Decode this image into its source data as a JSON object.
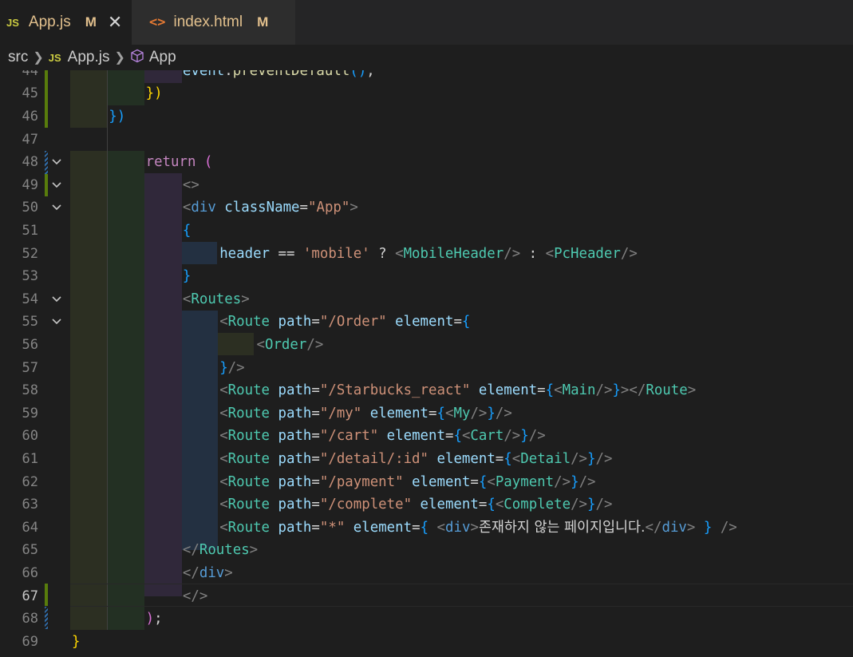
{
  "tabs": [
    {
      "icon": "JS",
      "name": "App.js",
      "status": "M",
      "close": "✕"
    },
    {
      "icon": "<>",
      "name": "index.html",
      "status": "M"
    }
  ],
  "breadcrumb": {
    "folder": "src",
    "file_icon": "JS",
    "file": "App.js",
    "symbol": "App"
  },
  "code": {
    "lines": {
      "44": [
        "event",
        ".",
        "preventDefault",
        "(",
        ")",
        ";"
      ],
      "45": [
        "})"
      ],
      "46": [
        "})"
      ],
      "48": [
        "return",
        " ("
      ],
      "49": [
        "<>"
      ],
      "50": [
        "<",
        "div",
        " ",
        "className",
        "=",
        "\"App\"",
        ">"
      ],
      "51": [
        "{"
      ],
      "52": [
        "header",
        " == ",
        "'mobile'",
        " ? ",
        "<",
        "MobileHeader",
        "/>",
        " : ",
        "<",
        "PcHeader",
        "/>"
      ],
      "53": [
        "}"
      ],
      "54": [
        "<",
        "Routes",
        ">"
      ],
      "55": [
        "<",
        "Route",
        " ",
        "path",
        "=",
        "\"/Order\"",
        " ",
        "element",
        "=",
        "{"
      ],
      "56": [
        "<",
        "Order",
        "/>"
      ],
      "57": [
        "}",
        "/>"
      ],
      "58": [
        "<",
        "Route",
        " ",
        "path",
        "=",
        "\"/Starbucks_react\"",
        " ",
        "element",
        "=",
        "{",
        "<",
        "Main",
        "/>",
        "}",
        "></",
        "Route",
        ">"
      ],
      "59": [
        "<",
        "Route",
        " ",
        "path",
        "=",
        "\"/my\"",
        " ",
        "element",
        "=",
        "{",
        "<",
        "My",
        "/>",
        "}",
        "/>"
      ],
      "60": [
        "<",
        "Route",
        " ",
        "path",
        "=",
        "\"/cart\"",
        " ",
        "element",
        "=",
        "{",
        "<",
        "Cart",
        "/>",
        "}",
        "/>"
      ],
      "61": [
        "<",
        "Route",
        " ",
        "path",
        "=",
        "\"/detail/:id\"",
        " ",
        "element",
        "=",
        "{",
        "<",
        "Detail",
        "/>",
        "}",
        "/>"
      ],
      "62": [
        "<",
        "Route",
        " ",
        "path",
        "=",
        "\"/payment\"",
        " ",
        "element",
        "=",
        "{",
        "<",
        "Payment",
        "/>",
        "}",
        "/>"
      ],
      "63": [
        "<",
        "Route",
        " ",
        "path",
        "=",
        "\"/complete\"",
        " ",
        "element",
        "=",
        "{",
        "<",
        "Complete",
        "/>",
        "}",
        "/>"
      ],
      "64": [
        "<",
        "Route",
        " ",
        "path",
        "=",
        "\"*\"",
        " ",
        "element",
        "=",
        "{",
        " ",
        "<",
        "div",
        ">",
        "존재하지 않는 페이지입니다.",
        "</",
        "div",
        ">",
        " ",
        "}",
        " />"
      ],
      "65": [
        "</",
        "Routes",
        ">"
      ],
      "66": [
        "</",
        "div",
        ">"
      ],
      "67": [
        "</>"
      ],
      "68": [
        ")",
        ";"
      ],
      "69": [
        "}"
      ]
    }
  },
  "colors": {
    "keyword": "#c586c0",
    "tag_name": "#569cd6",
    "component": "#4ec9b0",
    "attribute": "#9cdcfe",
    "string": "#ce9178",
    "function": "#dcdcaa"
  }
}
